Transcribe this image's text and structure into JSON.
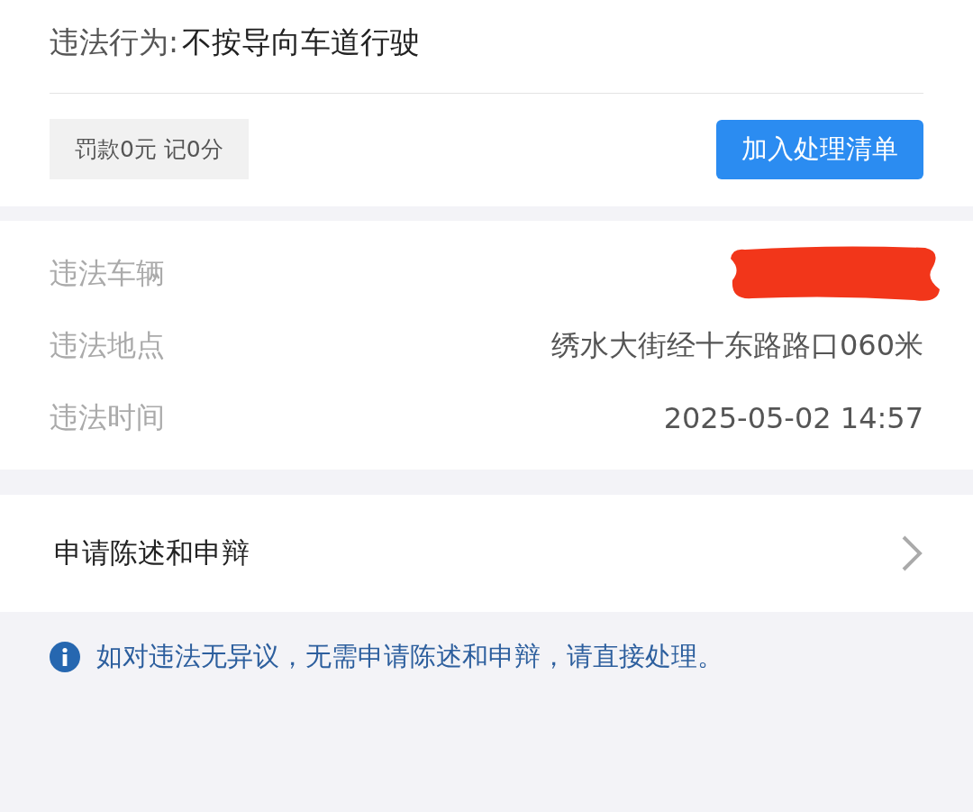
{
  "violation": {
    "label": "违法行为:",
    "value": "不按导向车道行驶"
  },
  "penalty": {
    "tag": "罚款0元 记0分",
    "button": "加入处理清单"
  },
  "details": [
    {
      "label": "违法车辆",
      "redacted": true
    },
    {
      "label": "违法地点",
      "value": "绣水大街经十东路路口060米",
      "redacted": false
    },
    {
      "label": "违法时间",
      "value": "2025-05-02 14:57",
      "redacted": false
    }
  ],
  "appeal": {
    "label": "申请陈述和申辩"
  },
  "notice": "如对违法无异议，无需申请陈述和申辩，请直接处理。"
}
